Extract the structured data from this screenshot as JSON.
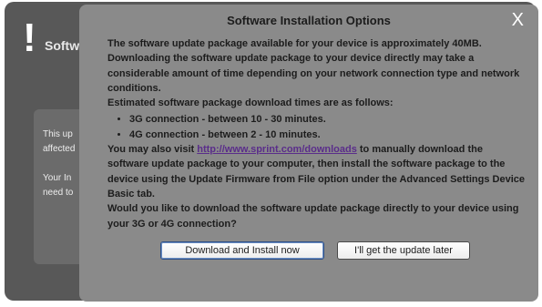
{
  "background": {
    "title_fragment": "Softwa",
    "icon": "exclamation-icon",
    "panel_lines": [
      "This up",
      "affected",
      "Your In",
      "need to"
    ]
  },
  "modal": {
    "title": "Software Installation Options",
    "close_label": "X",
    "intro": "The software update package available for your device is approximately 40MB. Downloading the software update package to your device directly may take a considerable amount of time depending on your network connection type and network conditions.",
    "estimate_heading": "Estimated software package download times are as follows:",
    "estimates": [
      "3G connection - between 10 - 30 minutes.",
      "4G connection - between 2 - 10 minutes."
    ],
    "visit_prefix": "You may also visit ",
    "visit_link": "http://www.sprint.com/downloads",
    "visit_suffix": " to manually download the software update package to your computer, then install the software package to the device using the Update Firmware from File option under the Advanced Settings Device Basic tab.",
    "question": "Would you like to download the software update package directly to your device using your 3G or 4G connection?",
    "buttons": {
      "primary": "Download and Install now",
      "secondary": "I'll get the update later"
    }
  },
  "colors": {
    "panel": "#585858",
    "modal": "#8a8a8a",
    "link": "#5a2d8a"
  }
}
